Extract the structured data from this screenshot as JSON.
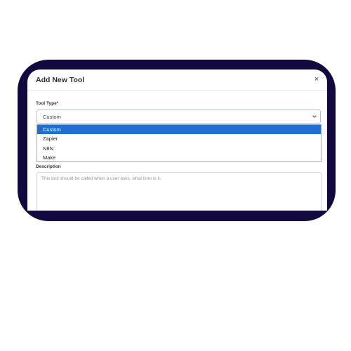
{
  "modal": {
    "title": "Add New Tool",
    "close_icon": "close-icon",
    "close_glyph": "×"
  },
  "tool_type": {
    "label": "Tool Type*",
    "selected_value": "Custom",
    "chevron_icon": "chevron-down-icon",
    "options": [
      "Custom",
      "Zapier",
      "N8N",
      "Make"
    ],
    "highlighted_option": "Custom"
  },
  "description": {
    "label": "Description",
    "placeholder": "This tool should be called when a user asks, what time is it."
  },
  "colors": {
    "frame": "#14093f",
    "selected_option_bg": "#1f6fd2"
  }
}
